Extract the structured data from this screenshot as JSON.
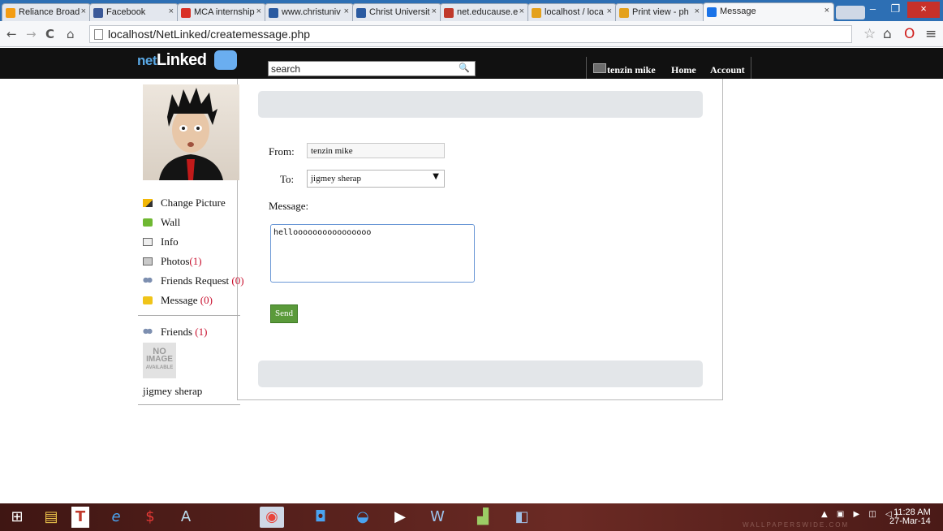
{
  "browser": {
    "tabs": [
      {
        "title": "Reliance Broad",
        "fav": "reliance-icon",
        "color": "#f39c12"
      },
      {
        "title": "Facebook",
        "fav": "facebook-icon",
        "color": "#3b5998"
      },
      {
        "title": "MCA internship",
        "fav": "gmail-icon",
        "color": "#d93025"
      },
      {
        "title": "www.christuniv",
        "fav": "christ-icon",
        "color": "#2a5aa0"
      },
      {
        "title": "Christ Universit",
        "fav": "christ-icon",
        "color": "#2a5aa0"
      },
      {
        "title": "net.educause.e",
        "fav": "educause-icon",
        "color": "#c0392b"
      },
      {
        "title": "localhost / loca",
        "fav": "phpmyadmin-icon",
        "color": "#e4a11b"
      },
      {
        "title": "Print view - ph",
        "fav": "phpmyadmin-icon",
        "color": "#e4a11b"
      },
      {
        "title": "Message",
        "fav": "netlinked-icon",
        "color": "#1a73e8"
      }
    ],
    "tab_close": "×",
    "url": "localhost/NetLinked/createmessage.php"
  },
  "header": {
    "logo_prefix": "net",
    "logo_main": "Linked",
    "search_value": "search",
    "user": "tenzin mike",
    "home": "Home",
    "account": "Account"
  },
  "sidebar": {
    "items": [
      {
        "label": "Change Picture",
        "count": ""
      },
      {
        "label": "Wall",
        "count": ""
      },
      {
        "label": "Info",
        "count": ""
      },
      {
        "label": "Photos",
        "count": "(1)"
      },
      {
        "label": "Friends Request ",
        "count": "(0)"
      },
      {
        "label": "Message ",
        "count": "(0)"
      }
    ],
    "friends_label": "Friends ",
    "friends_count": "(1)",
    "noimg": [
      "NO",
      "IMAGE",
      "AVAILABLE"
    ],
    "friend_name": "jigmey sherap"
  },
  "form": {
    "from_label": "From:",
    "from_value": "tenzin mike",
    "to_label": "To:",
    "to_value": "jigmey sherap",
    "message_label": "Message:",
    "message_value": "helloooooooooooooooo",
    "send_label": "Send"
  },
  "taskbar": {
    "time": "11:28 AM",
    "date": "27-Mar-14",
    "watermark": "WALLPAPERSWIDE.COM"
  }
}
